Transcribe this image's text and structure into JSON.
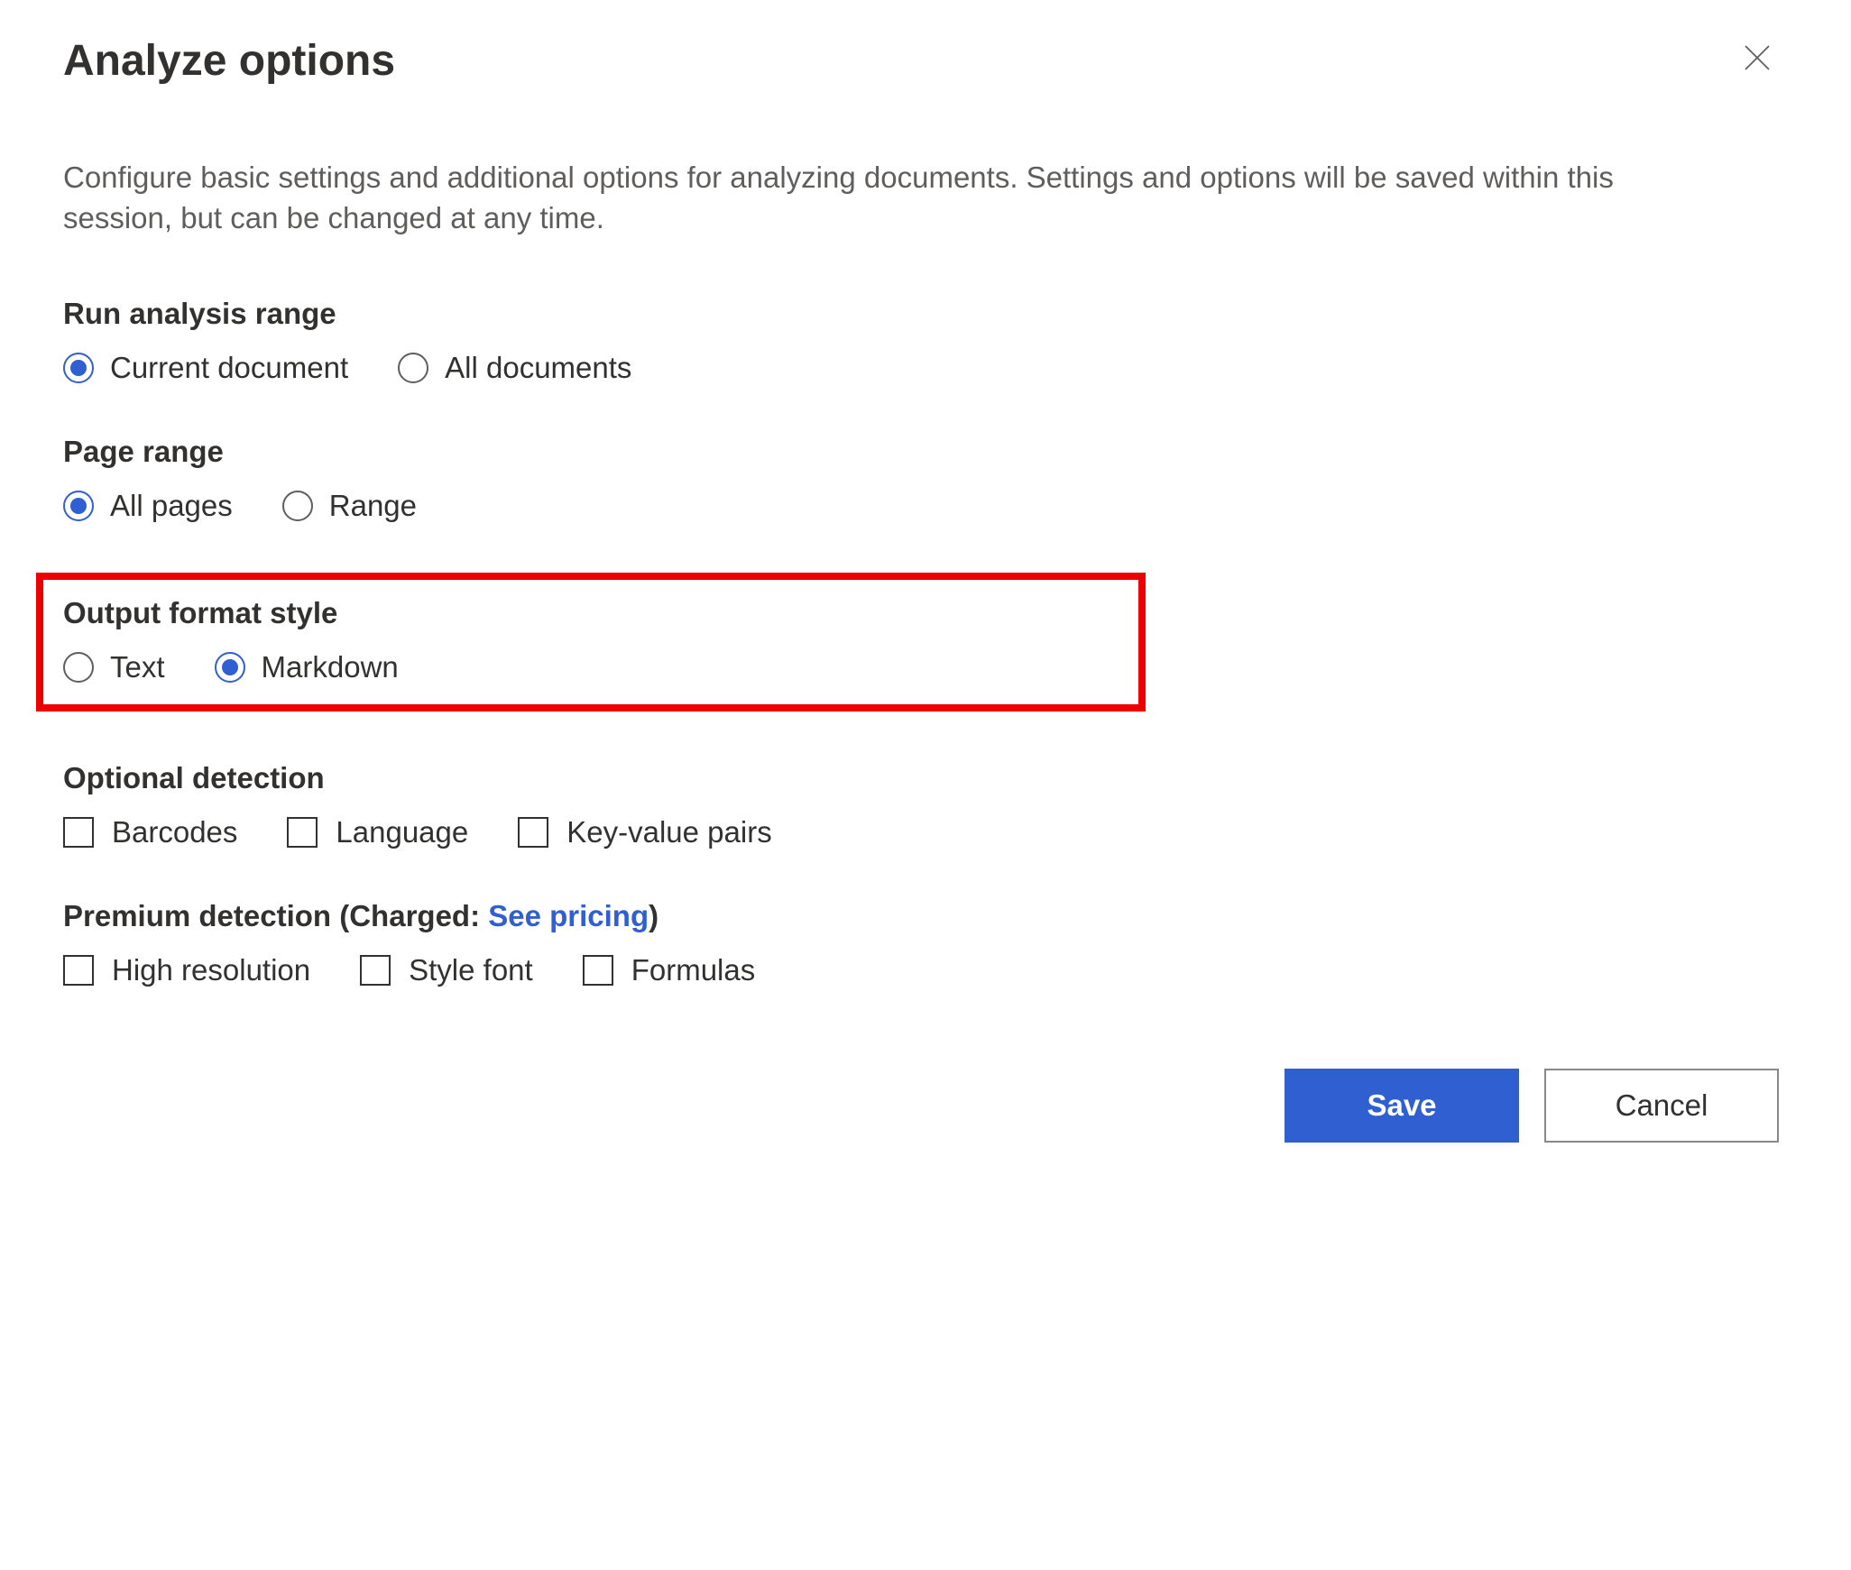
{
  "dialog": {
    "title": "Analyze options",
    "description": "Configure basic settings and additional options for analyzing documents. Settings and options will be saved within this session, but can be changed at any time."
  },
  "runAnalysisRange": {
    "label": "Run analysis range",
    "options": [
      {
        "label": "Current document",
        "selected": true
      },
      {
        "label": "All documents",
        "selected": false
      }
    ]
  },
  "pageRange": {
    "label": "Page range",
    "options": [
      {
        "label": "All pages",
        "selected": true
      },
      {
        "label": "Range",
        "selected": false
      }
    ]
  },
  "outputFormat": {
    "label": "Output format style",
    "options": [
      {
        "label": "Text",
        "selected": false
      },
      {
        "label": "Markdown",
        "selected": true
      }
    ]
  },
  "optionalDetection": {
    "label": "Optional detection",
    "options": [
      {
        "label": "Barcodes",
        "checked": false
      },
      {
        "label": "Language",
        "checked": false
      },
      {
        "label": "Key-value pairs",
        "checked": false
      }
    ]
  },
  "premiumDetection": {
    "label_prefix": "Premium detection (Charged: ",
    "link_text": "See pricing",
    "label_suffix": ")",
    "options": [
      {
        "label": "High resolution",
        "checked": false
      },
      {
        "label": "Style font",
        "checked": false
      },
      {
        "label": "Formulas",
        "checked": false
      }
    ]
  },
  "footer": {
    "save": "Save",
    "cancel": "Cancel"
  }
}
